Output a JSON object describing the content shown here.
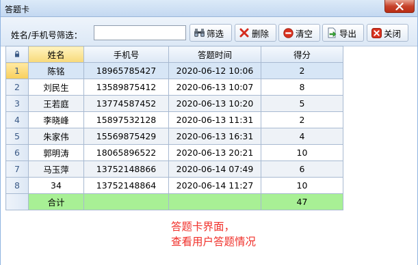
{
  "window": {
    "title": "答题卡"
  },
  "toolbar": {
    "filter_label": "姓名/手机号筛选：",
    "filter_value": "",
    "buttons": {
      "filter": "筛选",
      "delete": "删除",
      "clear": "清空",
      "export": "导出",
      "close": "关闭"
    }
  },
  "table": {
    "headers": {
      "name": "姓名",
      "phone": "手机号",
      "time": "答题时间",
      "score": "得分"
    },
    "rows": [
      {
        "index": "1",
        "name": "陈铭",
        "phone": "18965785427",
        "time": "2020-06-12 10:06",
        "score": "2"
      },
      {
        "index": "2",
        "name": "刘民生",
        "phone": "13589875412",
        "time": "2020-06-13 10:07",
        "score": "8"
      },
      {
        "index": "3",
        "name": "王若庭",
        "phone": "13774587452",
        "time": "2020-06-13 10:20",
        "score": "5"
      },
      {
        "index": "4",
        "name": "李晓峰",
        "phone": "15897532128",
        "time": "2020-06-13 11:31",
        "score": "2"
      },
      {
        "index": "5",
        "name": "朱家伟",
        "phone": "15569875429",
        "time": "2020-06-13 16:31",
        "score": "4"
      },
      {
        "index": "6",
        "name": "郭明涛",
        "phone": "18065896522",
        "time": "2020-06-13 20:21",
        "score": "10"
      },
      {
        "index": "7",
        "name": "马玉萍",
        "phone": "13752148866",
        "time": "2020-06-14 07:49",
        "score": "6"
      },
      {
        "index": "8",
        "name": "34",
        "phone": "13752148864",
        "time": "2020-06-14 11:27",
        "score": "10"
      }
    ],
    "total": {
      "label": "合计",
      "score": "47"
    }
  },
  "annotation": {
    "line1": "答题卡界面，",
    "line2": "查看用户答题情况"
  },
  "icons": {
    "filter": "binoculars-icon",
    "delete": "red-x-icon",
    "clear": "red-minus-circle-icon",
    "export": "export-document-icon",
    "close": "red-x-close-icon",
    "lock": "lock-icon"
  },
  "colors": {
    "total_row": "#a8f095",
    "annotation": "#f0302a",
    "selected_row": "#d7e6f6"
  }
}
